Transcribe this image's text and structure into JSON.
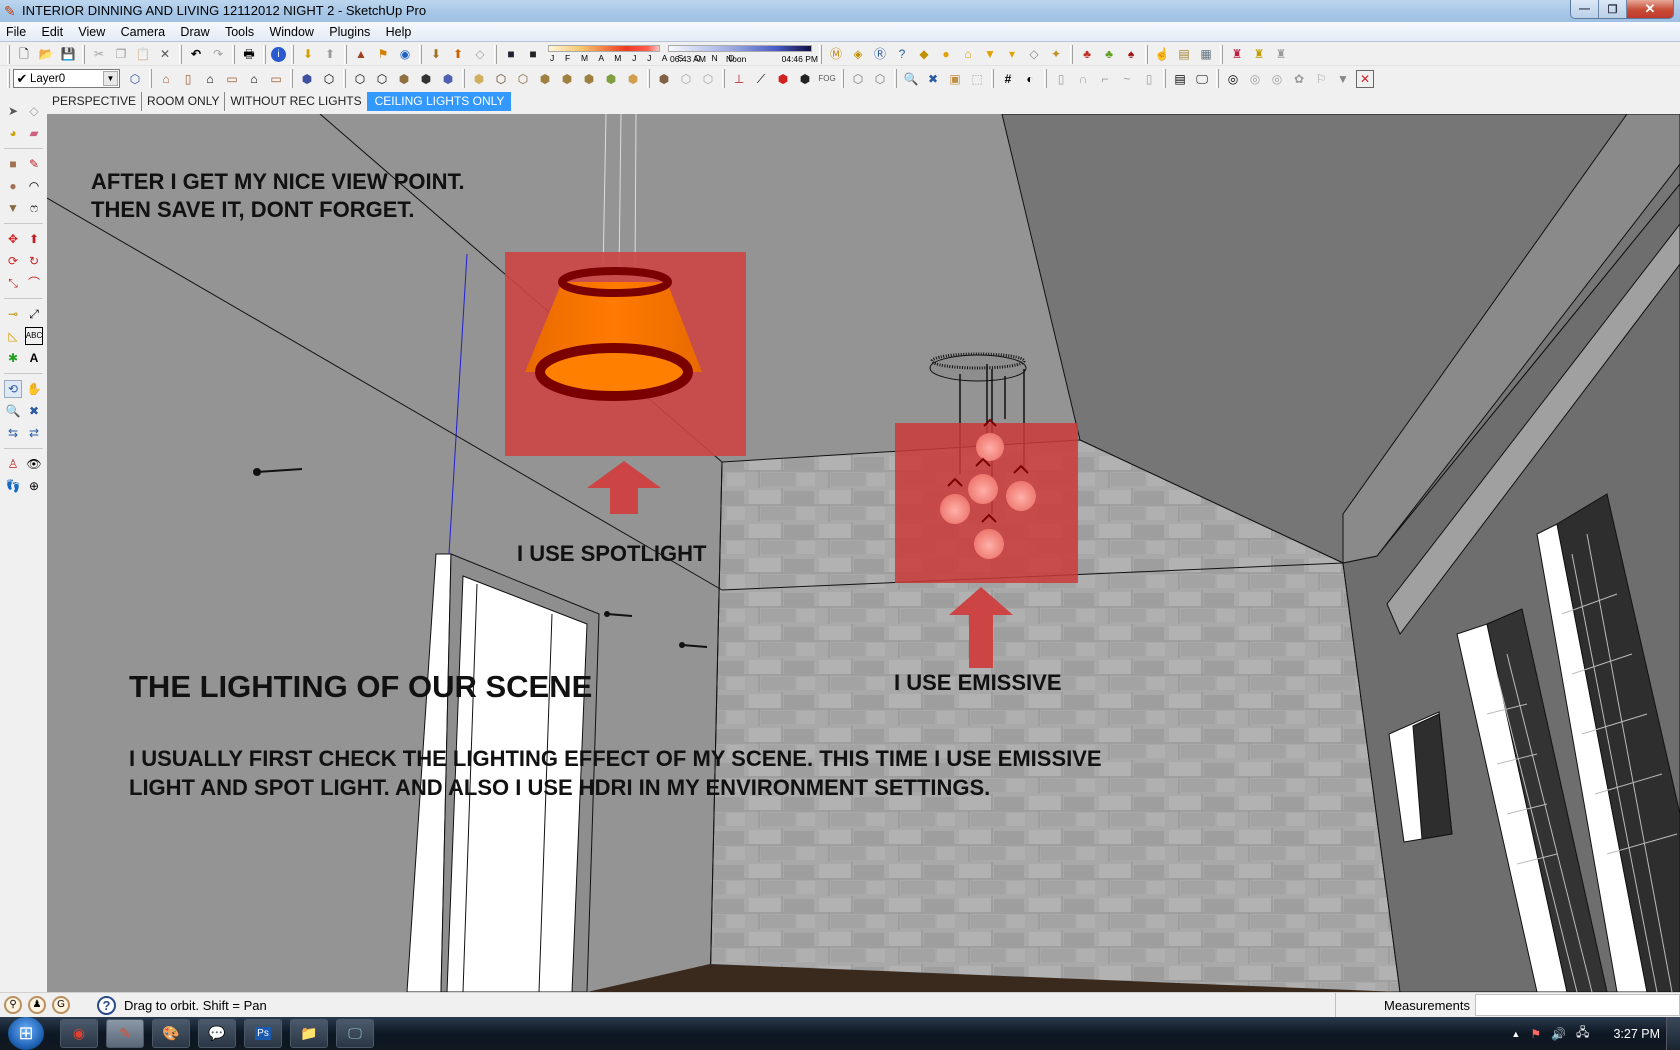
{
  "window": {
    "title": "INTERIOR DINNING AND LIVING 12112012 NIGHT 2 - SketchUp Pro",
    "app_icon": "sketchup-pencil-icon",
    "controls": {
      "minimize": "—",
      "restore": "❐",
      "close": "✕"
    }
  },
  "menubar": [
    "File",
    "Edit",
    "View",
    "Camera",
    "Draw",
    "Tools",
    "Window",
    "Plugins",
    "Help"
  ],
  "toolbar1": {
    "shadow_months": "J F M A M J J A S O N D",
    "time_start": "06:43 AM",
    "time_mid": "Noon",
    "time_end": "04:46 PM",
    "icons": [
      "new-icon",
      "open-icon",
      "save-icon",
      "cut-icon",
      "copy-icon",
      "paste-icon",
      "erase-icon",
      "undo-icon",
      "redo-icon",
      "print-icon",
      "model-info-icon",
      "get-models-icon",
      "share-model-icon",
      "photo-texture-icon",
      "add-location-icon",
      "toggle-terrain-icon",
      "google-earth-icon",
      "get-component-icon",
      "share-component-icon",
      "make-component-icon",
      "shadow-settings-icon",
      "display-shadows-icon",
      "material-editor-icon",
      "render-icon",
      "rotate-light-icon",
      "help-icon",
      "license-icon",
      "omni-light-icon",
      "spot-light-icon",
      "ies-light-icon",
      "pointer-light-icon",
      "sphere-light-icon",
      "emissive-icon",
      "plant-icon",
      "plant-edit-icon",
      "plant-rw-icon",
      "tool-a-icon",
      "tool-b-icon",
      "tool-c-icon",
      "bottle-red-icon",
      "bottle-yellow-icon",
      "bottle-white-icon"
    ]
  },
  "toolbar2": {
    "layer": {
      "checked": "✔",
      "name": "Layer0"
    }
  },
  "scene_tabs": [
    {
      "label": "PERSPECTIVE",
      "active": false
    },
    {
      "label": "ROOM ONLY",
      "active": false
    },
    {
      "label": "WITHOUT REC LIGHTS",
      "active": false
    },
    {
      "label": "CEILING LIGHTS ONLY",
      "active": true
    }
  ],
  "viewport": {
    "note_line1": "AFTER I GET MY NICE VIEW POINT.",
    "note_line2": "THEN SAVE IT, DONT FORGET.",
    "spotlight_label": "I USE SPOTLIGHT",
    "emissive_label": "I USE EMISSIVE",
    "heading": "THE LIGHTING OF OUR SCENE",
    "body_line1": "I USUALLY FIRST CHECK THE LIGHTING EFFECT OF MY SCENE. THIS TIME I USE EMISSIVE",
    "body_line2": "LIGHT AND SPOT LIGHT. AND ALSO I USE HDRI IN MY ENVIRONMENT SETTINGS.",
    "highlight_color": "#cc4444",
    "lamp_color": "#ff7700",
    "lamp_rim_color": "#7a0000"
  },
  "statusbar": {
    "hint": "Drag to orbit.  Shift = Pan",
    "measurements_label": "Measurements",
    "measurements_value": ""
  },
  "taskbar": {
    "apps": [
      "chrome-icon",
      "sketchup-icon",
      "paint-icon",
      "messenger-icon",
      "photoshop-icon",
      "explorer-icon",
      "screen-icon"
    ],
    "clock": "3:27 PM"
  }
}
